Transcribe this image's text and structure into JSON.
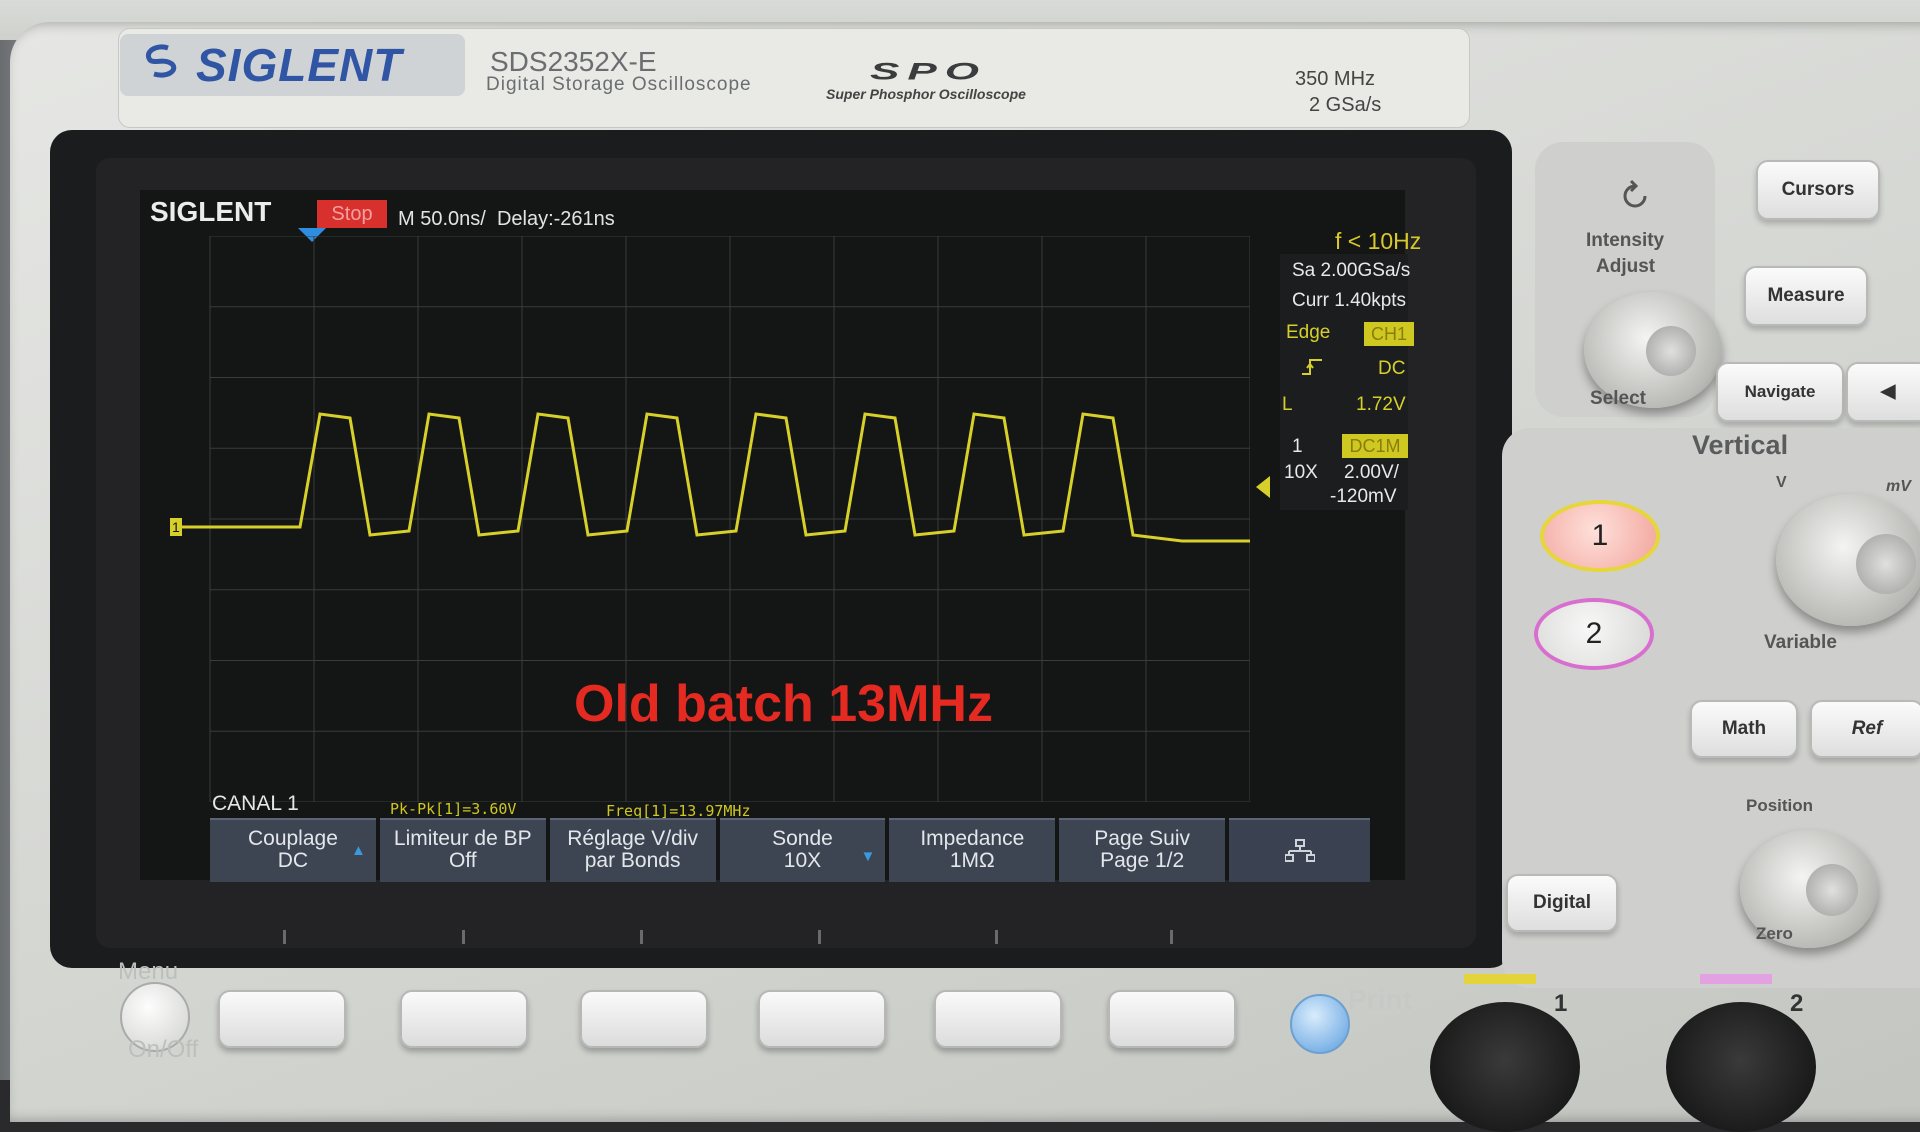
{
  "device": {
    "brand": "SIGLENT",
    "model": "SDS2352X-E",
    "model_subtitle": "Digital Storage Oscilloscope",
    "series_logo": "SPO",
    "series_subtitle": "Super Phosphor Oscilloscope",
    "spec_bandwidth": "350 MHz",
    "spec_sample_rate": "2 GSa/s"
  },
  "screen": {
    "logo": "SIGLENT",
    "run_state": "Stop",
    "timebase": "M 50.0ns/",
    "delay": "Delay:-261ns",
    "freq_indicator": "f < 10Hz",
    "sample_rate": "Sa 2.00GSa/s",
    "memory": "Curr 1.40kpts",
    "trigger": {
      "type": "Edge",
      "source": "CH1",
      "slope_icon": "rising-edge-icon",
      "coupling": "DC",
      "level_label": "L",
      "level": "1.72V"
    },
    "channel1": {
      "number": "1",
      "coupling": "DC1M",
      "probe": "10X",
      "scale": "2.00V/",
      "offset": "-120mV",
      "color": "#d8d02a"
    },
    "overlay_text": "Old batch 13MHz",
    "overlay_color": "#e52a22",
    "menu_title": "CANAL 1",
    "measurements": {
      "pkpk": "Pk-Pk[1]=3.60V",
      "freq": "Freq[1]=13.97MHz"
    },
    "softkeys": [
      {
        "line1": "Couplage",
        "line2": "DC"
      },
      {
        "line1": "Limiteur de BP",
        "line2": "Off"
      },
      {
        "line1": "Réglage V/div",
        "line2": "par Bonds"
      },
      {
        "line1": "Sonde",
        "line2": "10X"
      },
      {
        "line1": "Impedance",
        "line2": "1MΩ"
      },
      {
        "line1": "Page Suiv",
        "line2": "Page 1/2"
      }
    ],
    "network_icon": "network-icon"
  },
  "panel": {
    "menu_label": "Menu",
    "onoff_label": "On/Off",
    "print_label": "Print",
    "intensity_label": "Intensity",
    "adjust_label": "Adjust",
    "select_label": "Select",
    "cursors": "Cursors",
    "measure": "Measure",
    "navigate": "Navigate",
    "vertical_title": "Vertical",
    "ch1": "1",
    "ch2": "2",
    "volt_v": "V",
    "volt_mv": "mV",
    "variable_label": "Variable",
    "math": "Math",
    "ref": "Ref",
    "position_label": "Position",
    "digital": "Digital",
    "zero_label": "Zero",
    "bnc1": "1",
    "bnc2": "2"
  },
  "chart_data": {
    "type": "line",
    "title": "",
    "xlabel": "",
    "ylabel": "",
    "series": [
      {
        "name": "",
        "period_ns": 71.5,
        "pulses": 8,
        "high_v": 3.2,
        "low_v": 0.0,
        "pkpk_v": 3.6
      }
    ]
  }
}
